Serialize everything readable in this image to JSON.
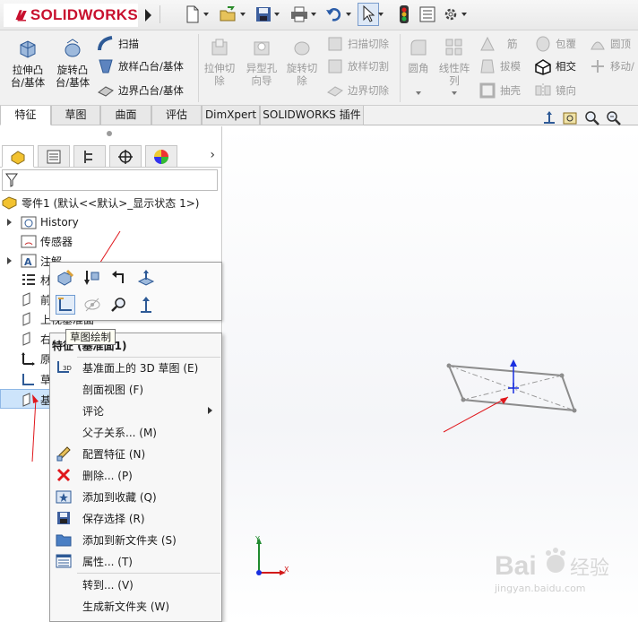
{
  "app": {
    "brand": "SOLIDWORKS"
  },
  "ribbon": {
    "extrude_boss": "拉伸凸\n台/基体",
    "revolve_boss": "旋转凸\n台/基体",
    "sweep": "扫描",
    "loft_boss": "放样凸台/基体",
    "boundary_boss": "边界凸台/基体",
    "extrude_cut": "拉伸切\n除",
    "hole_wizard": "异型孔\n向导",
    "revolve_cut": "旋转切\n除",
    "swept_cut": "扫描切除",
    "lofted_cut": "放样切割",
    "boundary_cut": "边界切除",
    "fillet": "圆角",
    "linear_pattern": "线性阵\n列",
    "rib": "筋",
    "draft": "拔模",
    "shell": "抽壳",
    "wrap": "包覆",
    "intersect": "相交",
    "mirror": "镜向",
    "dome": "圆顶",
    "move": "移动/"
  },
  "tabs": [
    "特征",
    "草图",
    "曲面",
    "评估",
    "DimXpert",
    "SOLIDWORKS 插件"
  ],
  "tree": {
    "part": "零件1  (默认<<默认>_显示状态 1>)",
    "history": "History",
    "sensors": "传感器",
    "annotations": "注解",
    "material": "材",
    "front_plane": "前",
    "top_plane": "上视基准面",
    "right_plane": "右",
    "origin": "原",
    "sketch": "草",
    "base": "基"
  },
  "tooltip": "草图绘制",
  "context_menu": {
    "header": "特征 (基准面1)",
    "items": [
      {
        "label": "基准面上的 3D 草图 (E)",
        "icon": "3d-sketch-icon"
      },
      {
        "label": "剖面视图 (F)",
        "icon": ""
      },
      {
        "label": "评论",
        "icon": "",
        "submenu": true
      },
      {
        "label": "父子关系... (M)",
        "icon": ""
      },
      {
        "label": "配置特征 (N)",
        "icon": "pencil-icon"
      },
      {
        "label": "删除... (P)",
        "icon": "delete-icon"
      },
      {
        "label": "添加到收藏 (Q)",
        "icon": "favorite-icon"
      },
      {
        "label": "保存选择 (R)",
        "icon": "save-selection-icon"
      },
      {
        "label": "添加到新文件夹 (S)",
        "icon": "folder-icon"
      },
      {
        "label": "属性... (T)",
        "icon": "properties-icon"
      },
      {
        "label": "转到... (V)",
        "icon": ""
      },
      {
        "label": "生成新文件夹 (W)",
        "icon": ""
      }
    ]
  },
  "colors": {
    "brand_red": "#c8102e",
    "annotation_red": "#e0171c",
    "triad_blue": "#1a2fe0"
  },
  "watermark": {
    "brand": "Bai",
    "brand_tail": "经验",
    "url": "jingyan.baidu.com"
  }
}
